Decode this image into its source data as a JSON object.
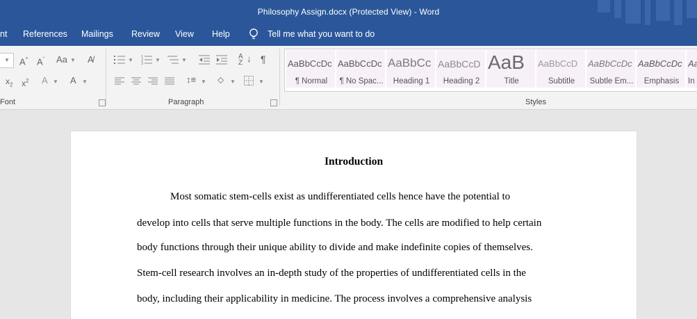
{
  "window": {
    "title": "Philosophy Assign.docx (Protected View)  -  Word"
  },
  "ribbon_tabs": [
    "nt",
    "References",
    "Mailings",
    "Review",
    "View",
    "Help"
  ],
  "tell_me": "Tell me what you want to do",
  "groups": {
    "font": "Font",
    "paragraph": "Paragraph",
    "styles": "Styles"
  },
  "styles": [
    {
      "sample": "AaBbCcDc",
      "name": "¶ Normal"
    },
    {
      "sample": "AaBbCcDc",
      "name": "¶ No Spac..."
    },
    {
      "sample": "AaBbCc",
      "name": "Heading 1"
    },
    {
      "sample": "AaBbCcD",
      "name": "Heading 2"
    },
    {
      "sample": "AaB",
      "name": "Title"
    },
    {
      "sample": "AaBbCcD",
      "name": "Subtitle"
    },
    {
      "sample": "AaBbCcDc",
      "name": "Subtle Em..."
    },
    {
      "sample": "AaBbCcDc",
      "name": "Emphasis"
    },
    {
      "sample": "Aa",
      "name": "In"
    }
  ],
  "document": {
    "heading": "Introduction",
    "lines": [
      "Most somatic stem-cells exist as undifferentiated cells hence have the potential to",
      "develop into cells that serve multiple functions in the body. The cells are modified to help certain",
      "body functions through their unique ability to divide and make indefinite copies of themselves.",
      "Stem-cell research involves an in-depth study of the properties of undifferentiated cells in the",
      "body, including their applicability in medicine. The process involves a comprehensive analysis"
    ]
  }
}
